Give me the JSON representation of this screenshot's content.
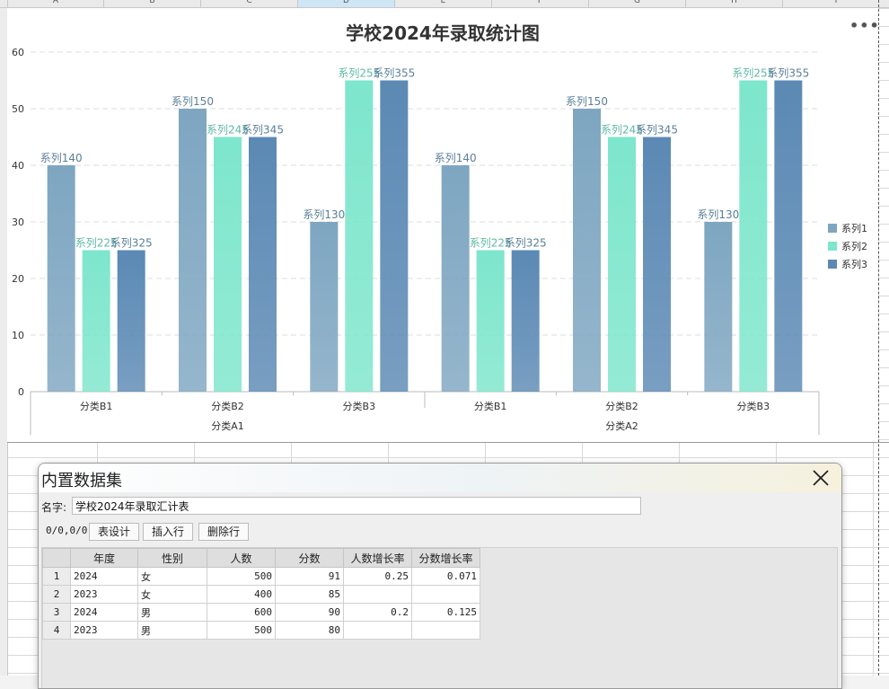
{
  "sheet": {
    "columns": [
      "A",
      "B",
      "C",
      "D",
      "E",
      "F",
      "G",
      "H",
      "I"
    ],
    "selected_column": "D"
  },
  "chart": {
    "more_label": "•••",
    "colors": {
      "series1": "#7ea6c1",
      "series2": "#7de6cc",
      "series3": "#5b89b4",
      "gridline": "#dddddd",
      "axis_text": "#333333",
      "label_text": "#5a7f99"
    }
  },
  "chart_data": {
    "type": "bar",
    "title": "学校2024年录取统计图",
    "ylim": [
      0,
      60
    ],
    "yticks": [
      0,
      10,
      20,
      30,
      40,
      50,
      60
    ],
    "grid": true,
    "legend_position": "right",
    "categories": [
      "分类B1",
      "分类B2",
      "分类B3",
      "分类B1",
      "分类B2",
      "分类B3"
    ],
    "groups": [
      {
        "label": "分类A1",
        "categories": [
          "分类B1",
          "分类B2",
          "分类B3"
        ]
      },
      {
        "label": "分类A2",
        "categories": [
          "分类B1",
          "分类B2",
          "分类B3"
        ]
      }
    ],
    "series": [
      {
        "name": "系列1",
        "values": [
          40,
          50,
          30,
          40,
          50,
          30
        ]
      },
      {
        "name": "系列2",
        "values": [
          25,
          45,
          55,
          25,
          45,
          55
        ]
      },
      {
        "name": "系列3",
        "values": [
          25,
          45,
          55,
          25,
          45,
          55
        ]
      }
    ],
    "data_labels": [
      [
        "系列140",
        "系列150",
        "系列130",
        "系列140",
        "系列150",
        "系列130"
      ],
      [
        "系列225",
        "系列245",
        "系列255",
        "系列225",
        "系列245",
        "系列255"
      ],
      [
        "系列325",
        "系列345",
        "系列355",
        "系列325",
        "系列345",
        "系列355"
      ]
    ]
  },
  "dialog": {
    "title": "内置数据集",
    "name_label": "名字:",
    "name_value": "学校2024年录取汇计表",
    "coord": "0/0,0/0",
    "buttons": {
      "design": "表设计",
      "insert_row": "插入行",
      "delete_row": "删除行"
    },
    "table": {
      "headers": [
        "年度",
        "性别",
        "人数",
        "分数",
        "人数增长率",
        "分数增长率"
      ],
      "rows": [
        [
          "1",
          "2024",
          "女",
          "500",
          "91",
          "0.25",
          "0.071"
        ],
        [
          "2",
          "2023",
          "女",
          "400",
          "85",
          "",
          ""
        ],
        [
          "3",
          "2024",
          "男",
          "600",
          "90",
          "0.2",
          "0.125"
        ],
        [
          "4",
          "2023",
          "男",
          "500",
          "80",
          "",
          ""
        ]
      ]
    }
  }
}
